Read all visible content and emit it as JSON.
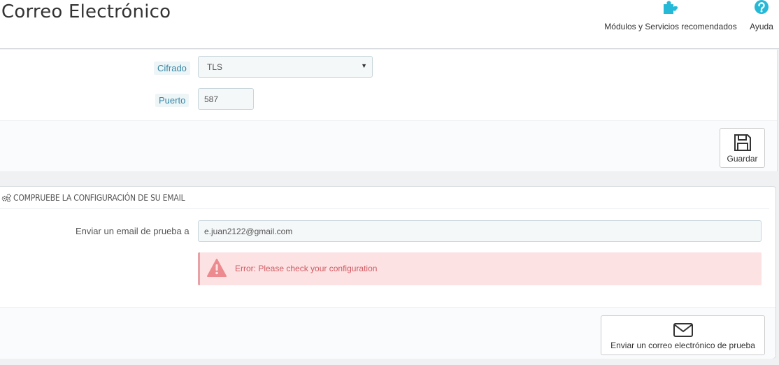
{
  "header": {
    "title": "Correo Electrónico",
    "modules_label": "Módulos y Servicios recomendados",
    "help_label": "Ayuda",
    "modules_icon": "puzzle-icon",
    "help_icon": "question-circle-icon",
    "accent_color": "#25b9d7"
  },
  "smtp_form": {
    "cifrado_label": "Cifrado",
    "cifrado_value": "TLS",
    "puerto_label": "Puerto",
    "puerto_value": "587",
    "save_label": "Guardar",
    "save_icon": "floppy-disk-icon"
  },
  "test_panel": {
    "heading": "COMPRUEBE LA CONFIGURACIÓN DE SU EMAIL",
    "heading_icon": "cogs-icon",
    "email_label": "Enviar un email de prueba a",
    "email_value": "e.juan2122@gmail.com",
    "error_message": "Error: Please check your configuration",
    "error_icon": "warning-icon",
    "error_color": "#cf5a62",
    "send_label": "Enviar un correo electrónico de prueba",
    "send_icon": "envelope-icon"
  }
}
